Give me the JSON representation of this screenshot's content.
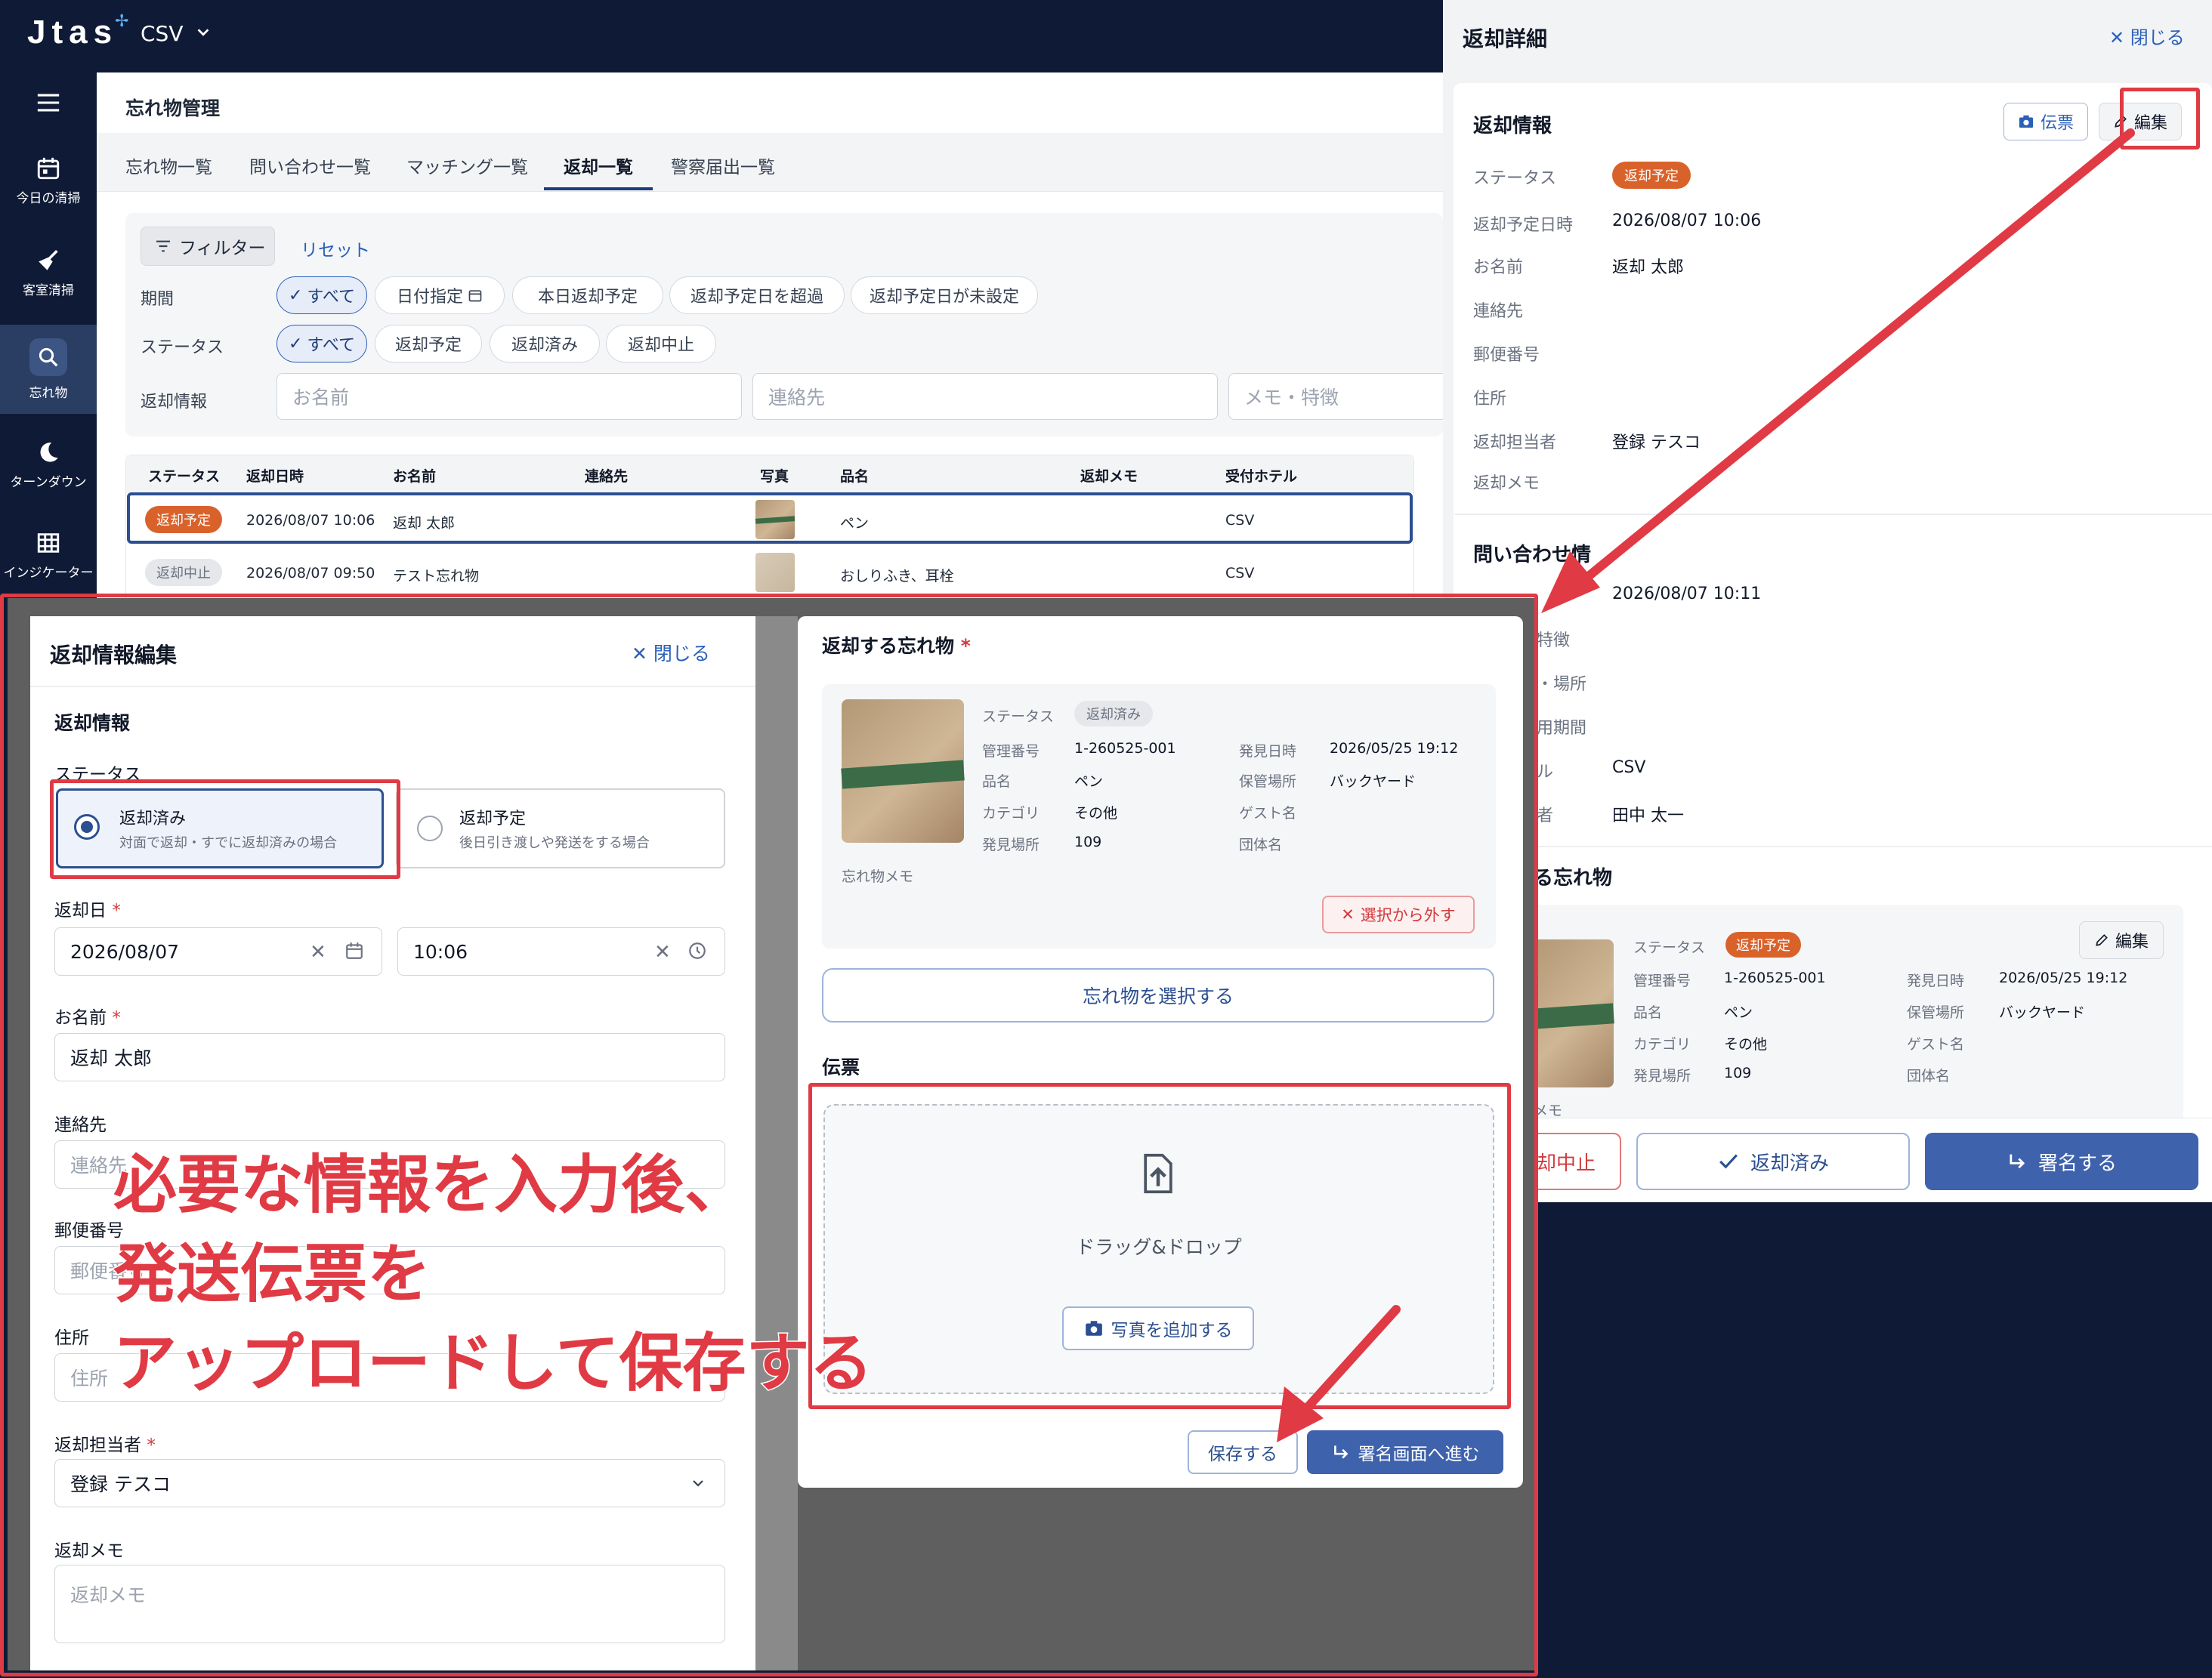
{
  "app": {
    "logo": "Jtas",
    "tenant": "CSV"
  },
  "sidenav": [
    {
      "label": "今日の清掃",
      "icon": "calendar-icon"
    },
    {
      "label": "客室清掃",
      "icon": "broom-icon"
    },
    {
      "label": "忘れ物",
      "icon": "search-icon"
    },
    {
      "label": "ターンダウン",
      "icon": "moon-icon"
    },
    {
      "label": "インジケーター",
      "icon": "grid-icon"
    }
  ],
  "page": {
    "title": "忘れ物管理"
  },
  "tabs": [
    "忘れ物一覧",
    "問い合わせ一覧",
    "マッチング一覧",
    "返却一覧",
    "警察届出一覧"
  ],
  "filter": {
    "button": "フィルター",
    "reset": "リセット",
    "period_label": "期間",
    "period_chips": [
      "すべて",
      "日付指定",
      "本日返却予定",
      "返却予定日を超過",
      "返却予定日が未設定"
    ],
    "status_label": "ステータス",
    "status_chips": [
      "すべて",
      "返却予定",
      "返却済み",
      "返却中止"
    ],
    "info_label": "返却情報",
    "name_placeholder": "お名前",
    "contact_placeholder": "連絡先",
    "memo_placeholder": "メモ・特徴"
  },
  "table": {
    "headers": [
      "ステータス",
      "返却日時",
      "お名前",
      "連絡先",
      "写真",
      "品名",
      "返却メモ",
      "受付ホテル"
    ],
    "rows": [
      {
        "status": "返却予定",
        "datetime": "2026/08/07 10:06",
        "name": "返却 太郎",
        "contact": "",
        "item": "ペン",
        "memo": "",
        "hotel": "CSV"
      },
      {
        "status": "返却中止",
        "datetime": "2026/08/07 09:50",
        "name": "テスト忘れ物",
        "contact": "",
        "item": "おしりふき、耳栓",
        "memo": "",
        "hotel": "CSV"
      }
    ]
  },
  "drawer": {
    "title": "返却詳細",
    "close": "閉じる",
    "section_return": "返却情報",
    "btn_slip": "伝票",
    "btn_edit": "編集",
    "fields": [
      {
        "label": "ステータス",
        "value": "返却予定"
      },
      {
        "label": "返却予定日時",
        "value": "2026/08/07 10:06"
      },
      {
        "label": "お名前",
        "value": "返却 太郎"
      },
      {
        "label": "連絡先",
        "value": ""
      },
      {
        "label": "郵便番号",
        "value": ""
      },
      {
        "label": "住所",
        "value": ""
      },
      {
        "label": "返却担当者",
        "value": "登録 テスコ"
      },
      {
        "label": "返却メモ",
        "value": ""
      }
    ],
    "section_inquiry": "問い合わせ情",
    "inquiry_datetime": "2026/08/07 10:11",
    "inquiry_partial_labels": [
      "特徴",
      "・場所",
      "用期間",
      "ル",
      "者"
    ],
    "inquiry_hotel": "CSV",
    "inquiry_person": "田中 太一",
    "section_items": "る忘れ物",
    "item": {
      "status_label": "ステータス",
      "status": "返却予定",
      "id_label": "管理番号",
      "id": "1-260525-001",
      "name_label": "品名",
      "name": "ペン",
      "category_label": "カテゴリ",
      "category": "その他",
      "place_label": "発見場所",
      "place": "109",
      "found_label": "発見日時",
      "found": "2026/05/25 19:12",
      "storage_label": "保管場所",
      "storage": "バックヤード",
      "guest_label": "ゲスト名",
      "guest": "",
      "group_label": "団体名",
      "group": "",
      "memo_partial": "メモ",
      "edit": "編集"
    },
    "btn_cancel": "却中止",
    "btn_returned": "返却済み",
    "btn_sign": "署名する"
  },
  "edit_modal": {
    "title": "返却情報編集",
    "close": "閉じる",
    "section": "返却情報",
    "status_label": "ステータス",
    "option_returned": {
      "title": "返却済み",
      "sub": "対面で返却・すでに返却済みの場合"
    },
    "option_planned": {
      "title": "返却予定",
      "sub": "後日引き渡しや発送をする場合"
    },
    "date_label": "返却日",
    "date_value": "2026/08/07",
    "time_value": "10:06",
    "name_label": "お名前",
    "name_value": "返却 太郎",
    "contact_label": "連絡先",
    "contact_placeholder": "連絡先",
    "zip_label": "郵便番号",
    "zip_placeholder": "郵便番号",
    "address_label": "住所",
    "address_placeholder": "住所",
    "staff_label": "返却担当者",
    "staff_value": "登録 テスコ",
    "memo_label": "返却メモ",
    "memo_placeholder": "返却メモ",
    "required_mark": "*"
  },
  "items_modal": {
    "title": "返却する忘れ物",
    "item": {
      "status_label": "ステータス",
      "status": "返却済み",
      "id_label": "管理番号",
      "id": "1-260525-001",
      "name_label": "品名",
      "name": "ペン",
      "category_label": "カテゴリ",
      "category": "その他",
      "place_label": "発見場所",
      "place": "109",
      "found_label": "発見日時",
      "found": "2026/05/25 19:12",
      "storage_label": "保管場所",
      "storage": "バックヤード",
      "guest_label": "ゲスト名",
      "group_label": "団体名",
      "memo_label": "忘れ物メモ"
    },
    "unselect": "選択から外す",
    "select_button": "忘れ物を選択する",
    "slip_label": "伝票",
    "drop_text": "ドラッグ&ドロップ",
    "add_photo": "写真を追加する",
    "save": "保存する",
    "next": "署名画面へ進む"
  },
  "annotation": "必要な情報を入力後、\n発送伝票を\nアップロードして保存する",
  "colors": {
    "navy": "#0f1b36",
    "accent_blue": "#2c4f91",
    "orange": "#d9622b",
    "annotation_red": "#e03a44"
  }
}
